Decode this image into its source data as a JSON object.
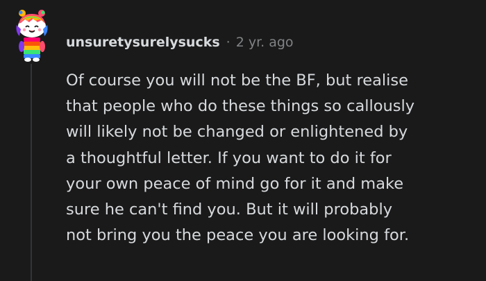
{
  "comment": {
    "author": "unsuretysurelysucks",
    "separator": "·",
    "age": "2 yr. ago",
    "body_lines": [
      "Of course you will not be the BF, but realise",
      "that people who do these things so callously",
      "will likely not be changed or enlightened by",
      "a thoughtful letter. If you want to do it for",
      "your own peace of mind go for it and make",
      "sure he can't find you. But it will probably",
      "not bring you the peace you are looking for."
    ]
  },
  "avatar": {
    "icon": "snoo-avatar-icon",
    "colors": {
      "head": "#ffffff",
      "hair": [
        "#ff4d6d",
        "#ffb703",
        "#3ae374",
        "#3a86ff",
        "#8338ec"
      ],
      "body": [
        "#ff006e",
        "#fb5607",
        "#ffbe0b",
        "#3ae374",
        "#3a86ff"
      ],
      "outline": "#1a1a1b"
    }
  },
  "theme": {
    "background": "#1a1a1b",
    "text": "#d7dadc",
    "meta": "#818384",
    "thread_line": "#343536"
  }
}
